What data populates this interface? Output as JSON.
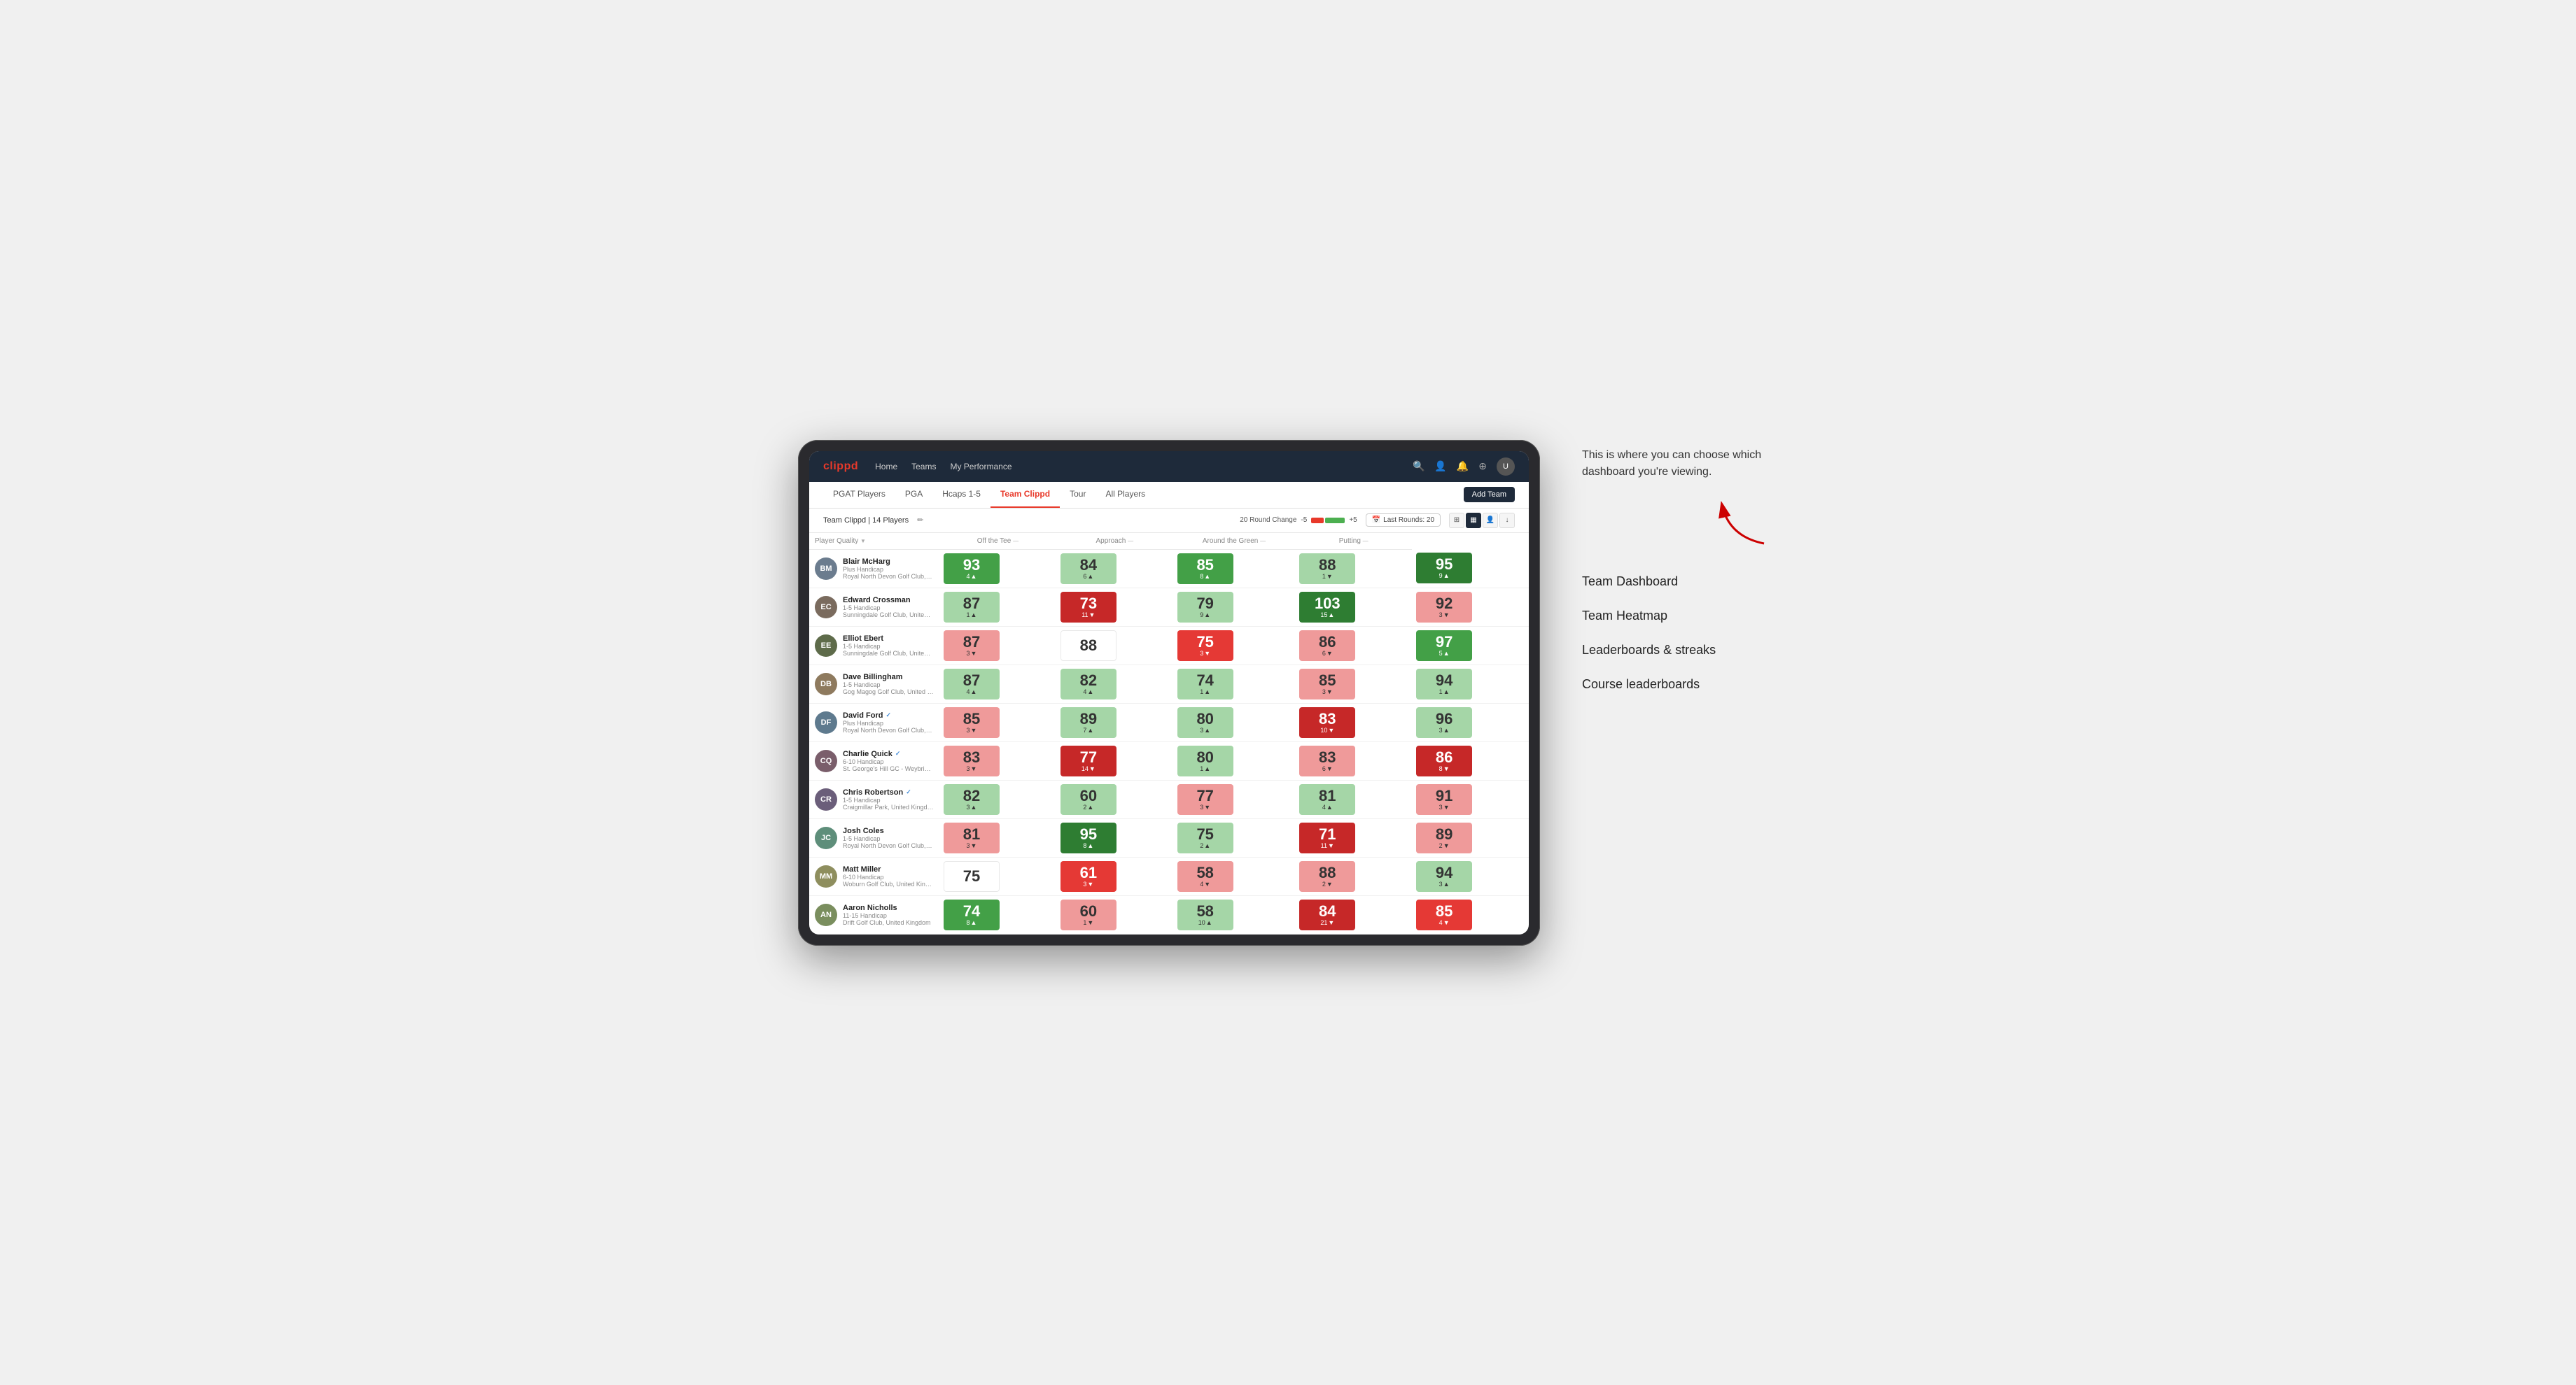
{
  "annotation": {
    "description": "This is where you can choose which dashboard you're viewing.",
    "arrow_label": "↗"
  },
  "menu_items": [
    "Team Dashboard",
    "Team Heatmap",
    "Leaderboards & streaks",
    "Course leaderboards"
  ],
  "nav": {
    "logo": "clippd",
    "links": [
      "Home",
      "Teams",
      "My Performance"
    ],
    "icons": [
      "🔍",
      "👤",
      "🔔",
      "⊕",
      "👤"
    ]
  },
  "sub_tabs": [
    {
      "label": "PGAT Players",
      "active": false
    },
    {
      "label": "PGA",
      "active": false
    },
    {
      "label": "Hcaps 1-5",
      "active": false
    },
    {
      "label": "Team Clippd",
      "active": true
    },
    {
      "label": "Tour",
      "active": false
    },
    {
      "label": "All Players",
      "active": false
    }
  ],
  "add_team_label": "Add Team",
  "table_controls": {
    "team_label": "Team Clippd | 14 Players",
    "round_change_label": "20 Round Change",
    "neg_label": "-5",
    "pos_label": "+5",
    "last_rounds_label": "Last Rounds: 20"
  },
  "col_headers": [
    {
      "label": "Player Quality",
      "sortable": true
    },
    {
      "label": "Off the Tee",
      "sortable": true
    },
    {
      "label": "Approach",
      "sortable": true
    },
    {
      "label": "Around the Green",
      "sortable": true
    },
    {
      "label": "Putting",
      "sortable": true
    }
  ],
  "players": [
    {
      "name": "Blair McHarg",
      "handicap": "Plus Handicap",
      "club": "Royal North Devon Golf Club, United Kingdom",
      "verified": false,
      "avatar_color": "#6b7c8e",
      "initials": "BM",
      "scores": [
        {
          "value": "93",
          "change": "4",
          "direction": "up",
          "bg": "bg-green-mid"
        },
        {
          "value": "84",
          "change": "6",
          "direction": "up",
          "bg": "bg-green-light"
        },
        {
          "value": "85",
          "change": "8",
          "direction": "up",
          "bg": "bg-green-mid"
        },
        {
          "value": "88",
          "change": "1",
          "direction": "down",
          "bg": "bg-green-light"
        },
        {
          "value": "95",
          "change": "9",
          "direction": "up",
          "bg": "bg-green-dark"
        }
      ]
    },
    {
      "name": "Edward Crossman",
      "handicap": "1-5 Handicap",
      "club": "Sunningdale Golf Club, United Kingdom",
      "verified": false,
      "avatar_color": "#7a6b5e",
      "initials": "EC",
      "scores": [
        {
          "value": "87",
          "change": "1",
          "direction": "up",
          "bg": "bg-green-light"
        },
        {
          "value": "73",
          "change": "11",
          "direction": "down",
          "bg": "bg-red-dark"
        },
        {
          "value": "79",
          "change": "9",
          "direction": "up",
          "bg": "bg-green-light"
        },
        {
          "value": "103",
          "change": "15",
          "direction": "up",
          "bg": "bg-green-dark"
        },
        {
          "value": "92",
          "change": "3",
          "direction": "down",
          "bg": "bg-red-light"
        }
      ]
    },
    {
      "name": "Elliot Ebert",
      "handicap": "1-5 Handicap",
      "club": "Sunningdale Golf Club, United Kingdom",
      "verified": false,
      "avatar_color": "#5e6b4a",
      "initials": "EE",
      "scores": [
        {
          "value": "87",
          "change": "3",
          "direction": "down",
          "bg": "bg-red-light"
        },
        {
          "value": "88",
          "change": "",
          "direction": "",
          "bg": "bg-white"
        },
        {
          "value": "75",
          "change": "3",
          "direction": "down",
          "bg": "bg-red-mid"
        },
        {
          "value": "86",
          "change": "6",
          "direction": "down",
          "bg": "bg-red-light"
        },
        {
          "value": "97",
          "change": "5",
          "direction": "up",
          "bg": "bg-green-mid"
        }
      ]
    },
    {
      "name": "Dave Billingham",
      "handicap": "1-5 Handicap",
      "club": "Gog Magog Golf Club, United Kingdom",
      "verified": false,
      "avatar_color": "#8e7a5e",
      "initials": "DB",
      "scores": [
        {
          "value": "87",
          "change": "4",
          "direction": "up",
          "bg": "bg-green-light"
        },
        {
          "value": "82",
          "change": "4",
          "direction": "up",
          "bg": "bg-green-light"
        },
        {
          "value": "74",
          "change": "1",
          "direction": "up",
          "bg": "bg-green-light"
        },
        {
          "value": "85",
          "change": "3",
          "direction": "down",
          "bg": "bg-red-light"
        },
        {
          "value": "94",
          "change": "1",
          "direction": "up",
          "bg": "bg-green-light"
        }
      ]
    },
    {
      "name": "David Ford",
      "handicap": "Plus Handicap",
      "club": "Royal North Devon Golf Club, United Kingdom",
      "verified": true,
      "avatar_color": "#5e7a8e",
      "initials": "DF",
      "scores": [
        {
          "value": "85",
          "change": "3",
          "direction": "down",
          "bg": "bg-red-light"
        },
        {
          "value": "89",
          "change": "7",
          "direction": "up",
          "bg": "bg-green-light"
        },
        {
          "value": "80",
          "change": "3",
          "direction": "up",
          "bg": "bg-green-light"
        },
        {
          "value": "83",
          "change": "10",
          "direction": "down",
          "bg": "bg-red-dark"
        },
        {
          "value": "96",
          "change": "3",
          "direction": "up",
          "bg": "bg-green-light"
        }
      ]
    },
    {
      "name": "Charlie Quick",
      "handicap": "6-10 Handicap",
      "club": "St. George's Hill GC - Weybridge - Surrey, Uni...",
      "verified": true,
      "avatar_color": "#7a5e6b",
      "initials": "CQ",
      "scores": [
        {
          "value": "83",
          "change": "3",
          "direction": "down",
          "bg": "bg-red-light"
        },
        {
          "value": "77",
          "change": "14",
          "direction": "down",
          "bg": "bg-red-dark"
        },
        {
          "value": "80",
          "change": "1",
          "direction": "up",
          "bg": "bg-green-light"
        },
        {
          "value": "83",
          "change": "6",
          "direction": "down",
          "bg": "bg-red-light"
        },
        {
          "value": "86",
          "change": "8",
          "direction": "down",
          "bg": "bg-red-dark"
        }
      ]
    },
    {
      "name": "Chris Robertson",
      "handicap": "1-5 Handicap",
      "club": "Craigmillar Park, United Kingdom",
      "verified": true,
      "avatar_color": "#6b5e7a",
      "initials": "CR",
      "scores": [
        {
          "value": "82",
          "change": "3",
          "direction": "up",
          "bg": "bg-green-light"
        },
        {
          "value": "60",
          "change": "2",
          "direction": "up",
          "bg": "bg-green-light"
        },
        {
          "value": "77",
          "change": "3",
          "direction": "down",
          "bg": "bg-red-light"
        },
        {
          "value": "81",
          "change": "4",
          "direction": "up",
          "bg": "bg-green-light"
        },
        {
          "value": "91",
          "change": "3",
          "direction": "down",
          "bg": "bg-red-light"
        }
      ]
    },
    {
      "name": "Josh Coles",
      "handicap": "1-5 Handicap",
      "club": "Royal North Devon Golf Club, United Kingdom",
      "verified": false,
      "avatar_color": "#5e8e7a",
      "initials": "JC",
      "scores": [
        {
          "value": "81",
          "change": "3",
          "direction": "down",
          "bg": "bg-red-light"
        },
        {
          "value": "95",
          "change": "8",
          "direction": "up",
          "bg": "bg-green-dark"
        },
        {
          "value": "75",
          "change": "2",
          "direction": "up",
          "bg": "bg-green-light"
        },
        {
          "value": "71",
          "change": "11",
          "direction": "down",
          "bg": "bg-red-dark"
        },
        {
          "value": "89",
          "change": "2",
          "direction": "down",
          "bg": "bg-red-light"
        }
      ]
    },
    {
      "name": "Matt Miller",
      "handicap": "6-10 Handicap",
      "club": "Woburn Golf Club, United Kingdom",
      "verified": false,
      "avatar_color": "#8e8e5e",
      "initials": "MM",
      "scores": [
        {
          "value": "75",
          "change": "",
          "direction": "",
          "bg": "bg-white"
        },
        {
          "value": "61",
          "change": "3",
          "direction": "down",
          "bg": "bg-red-mid"
        },
        {
          "value": "58",
          "change": "4",
          "direction": "down",
          "bg": "bg-red-light"
        },
        {
          "value": "88",
          "change": "2",
          "direction": "down",
          "bg": "bg-red-light"
        },
        {
          "value": "94",
          "change": "3",
          "direction": "up",
          "bg": "bg-green-light"
        }
      ]
    },
    {
      "name": "Aaron Nicholls",
      "handicap": "11-15 Handicap",
      "club": "Drift Golf Club, United Kingdom",
      "verified": false,
      "avatar_color": "#7a8e5e",
      "initials": "AN",
      "scores": [
        {
          "value": "74",
          "change": "8",
          "direction": "up",
          "bg": "bg-green-mid"
        },
        {
          "value": "60",
          "change": "1",
          "direction": "down",
          "bg": "bg-red-light"
        },
        {
          "value": "58",
          "change": "10",
          "direction": "up",
          "bg": "bg-green-light"
        },
        {
          "value": "84",
          "change": "21",
          "direction": "down",
          "bg": "bg-red-dark"
        },
        {
          "value": "85",
          "change": "4",
          "direction": "down",
          "bg": "bg-red-mid"
        }
      ]
    }
  ]
}
